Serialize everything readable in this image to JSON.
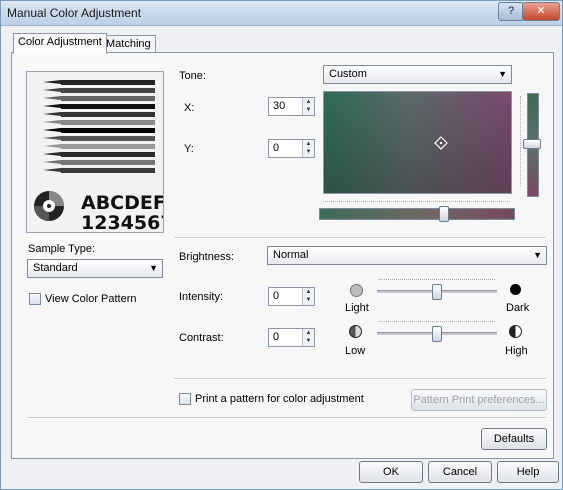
{
  "window": {
    "title": "Manual Color Adjustment"
  },
  "tabs": [
    {
      "label": "Color Adjustment"
    },
    {
      "label": "Matching"
    }
  ],
  "sample": {
    "line1": "ABCDEF",
    "line2": "1234567"
  },
  "sample_type": {
    "label": "Sample Type:",
    "value": "Standard"
  },
  "view_pattern": {
    "label": "View Color Pattern",
    "checked": false
  },
  "tone": {
    "label": "Tone:",
    "value": "Custom"
  },
  "x": {
    "label": "X:",
    "value": "30"
  },
  "y": {
    "label": "Y:",
    "value": "0"
  },
  "brightness": {
    "label": "Brightness:",
    "value": "Normal"
  },
  "intensity": {
    "label": "Intensity:",
    "value": "0",
    "low": "Light",
    "high": "Dark"
  },
  "contrast": {
    "label": "Contrast:",
    "value": "0",
    "low": "Low",
    "high": "High"
  },
  "print_pattern": {
    "label": "Print a pattern for color adjustment",
    "checked": false
  },
  "buttons": {
    "pattern_prefs": "Pattern Print preferences...",
    "defaults": "Defaults",
    "ok": "OK",
    "cancel": "Cancel",
    "help": "Help"
  }
}
